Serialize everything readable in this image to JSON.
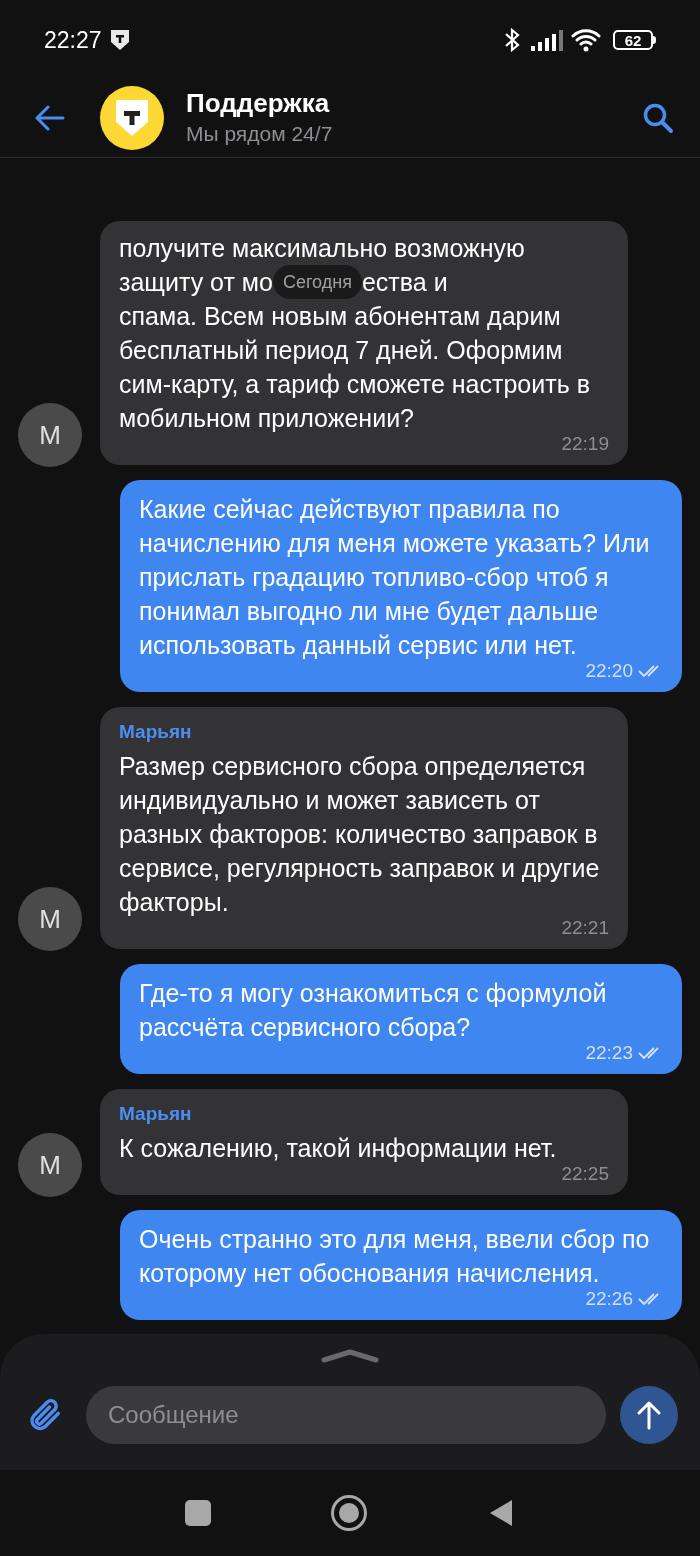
{
  "status_bar": {
    "time": "22:27",
    "battery": "62"
  },
  "header": {
    "title": "Поддержка",
    "subtitle": "Мы рядом 24/7"
  },
  "messages": [
    {
      "kind": "incoming",
      "avatar": "М",
      "text": "получите максимально возможную",
      "text_before_chip": "защиту от мо",
      "date_label": "Сегодня",
      "text_after_chip": "ества и",
      "text_continued": "спама. Всем новым абонентам дарим бесплатный период 7 дней. Оформим сим-карту, а тариф сможете настроить в мобильном приложении?",
      "time": "22:19"
    },
    {
      "kind": "outgoing",
      "text": "Какие сейчас действуют правила по начислению для меня можете указать? Или прислать градацию топливо-сбор чтоб я понимал выгодно ли мне будет дальше использовать данный сервис или нет.",
      "time": "22:20",
      "read": true
    },
    {
      "kind": "incoming",
      "avatar": "М",
      "sender": "Марьян",
      "text": "Размер сервисного сбора определяется индивидуально и может зависеть от разных факторов: количество заправок в сервисе, регулярность заправок и другие факторы.",
      "time": "22:21"
    },
    {
      "kind": "outgoing",
      "text": "Где-то я могу ознакомиться с формулой рассчёта сервисного сбора?",
      "time": "22:23",
      "read": true
    },
    {
      "kind": "incoming",
      "avatar": "М",
      "sender": "Марьян",
      "text": "К сожалению, такой информации нет.",
      "time": "22:25"
    },
    {
      "kind": "outgoing",
      "text": "Очень странно это для меня, ввели сбор по которому нет обоснования начисления.",
      "time": "22:26",
      "read": true
    }
  ],
  "composer": {
    "placeholder": "Сообщение"
  }
}
